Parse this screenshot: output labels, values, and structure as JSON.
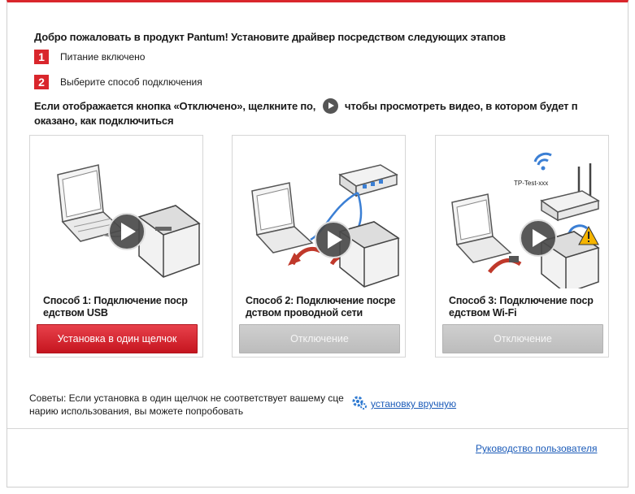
{
  "header": {
    "title": "Добро пожаловать в продукт Pantum! Установите драйвер посредством следующих этапов"
  },
  "steps": [
    {
      "num": "1",
      "label": "Питание включено"
    },
    {
      "num": "2",
      "label": "Выберите способ подключения"
    }
  ],
  "note": {
    "before": "Если отображается кнопка «Отключено», щелкните по,",
    "after": "чтобы просмотреть видео, в котором будет п оказано, как подключиться"
  },
  "methods": [
    {
      "caption": "Способ 1: Подключение поср едством USB",
      "button": "Установка в один щелчок"
    },
    {
      "caption": "Способ 2: Подключение посре дством проводной сети",
      "button": "Отключение"
    },
    {
      "caption": "Способ 3: Подключение поср едством Wi-Fi",
      "button": "Отключение",
      "router_label": "TP-Test-xxx"
    }
  ],
  "tips": {
    "text": "Советы: Если установка в один щелчок не соответствует вашему сце нарию использования, вы можете попробовать",
    "link": "установку вручную"
  },
  "footer": {
    "guide_link": "Руководство пользователя"
  },
  "colors": {
    "accent": "#d9262c",
    "link": "#1a5ab8",
    "disabled": "#c4c4c4"
  }
}
